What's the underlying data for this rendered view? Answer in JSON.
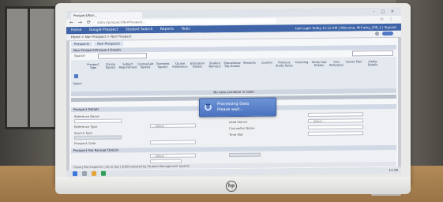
{
  "browser": {
    "tab_title": "Prospect/Non...",
    "url": "stdsvr/prospect/NonProspect...",
    "window_controls": "– ▢ ✕",
    "nav_glyphs": "← → ⟳",
    "bookmark_glyphs": "☆ ⋮"
  },
  "app": {
    "menu": [
      "Home",
      "Google Prospect",
      "Student Search",
      "Reports",
      "Tools"
    ],
    "login_text": "Last Login Today 11:15 AM | Welcome, MrCathy_230_1 | Signout",
    "breadcrumb": "Home > Non Prospect > Non Prospect"
  },
  "content": {
    "subtabs": [
      "Prospects",
      "Non Prospects"
    ],
    "section_title": "Non-Prospect/Prospect Details",
    "search_label": "Search",
    "grid_columns": [
      "Select",
      "Prospect Type",
      "Course Type(s)",
      "Subject Requirement",
      "Course/Lab Type(s)",
      "Overseas Type(s)",
      "Course Preference",
      "Education Details",
      "Student Name(s)",
      "Educational Trip Details",
      "Remarks",
      "Country",
      "Previous Study Dates",
      "Coaching",
      "Study Gap Details",
      "Visa Refusal(s)",
      "Career Plan",
      "Intake Details"
    ],
    "grid_empty_text": "No data available in table",
    "form_section_title": "Prospect Details",
    "form_labels": [
      "Reference Name",
      "Reference Type",
      "Source Type",
      "Prospect Code",
      "Follow-up date",
      "Lead Source",
      "Counsellor Name",
      "Time Slot"
    ],
    "form_placeholder": "-- Select --",
    "sub_section_title": "Prospect Fee Receipt Details",
    "bottom_text": "Close | File Inspector | Go to Top | 2020 powered by Student Management System"
  },
  "overlay": {
    "line1": "Processing Data",
    "line2": "Please wait..."
  },
  "device": {
    "brand": "hp"
  },
  "taskbar": {
    "clock": "11:38"
  }
}
